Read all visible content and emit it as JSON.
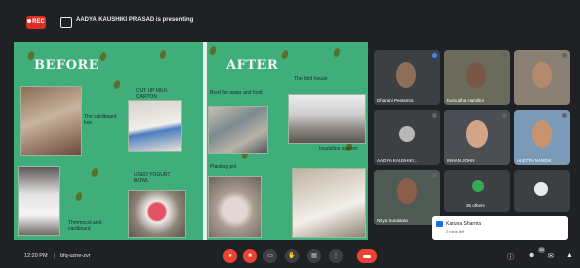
{
  "header": {
    "rec_label": "REC",
    "presenter_text": "AADYA KAUSHIKI PRASAD is presenting"
  },
  "slide": {
    "before_title": "BEFORE",
    "after_title": "AFTER",
    "labels": {
      "cardboard_box": "The cardboard box",
      "milk_carton": "CUT UP MILK CARTON",
      "yogurt_bowl": "USED YOGURT BOWL",
      "thermocol": "Thermocol and cardboard",
      "bowl_water": "Bowl for water and food",
      "bird_house": "The bird house",
      "planting_pot": "Planting pot",
      "insulation": "Insulation system"
    }
  },
  "participants": [
    {
      "name": "Dharani Peetamra"
    },
    {
      "name": "Kumudha Hamiltor"
    },
    {
      "name": ""
    },
    {
      "name": "AADYA KAUSHIKI..."
    },
    {
      "name": "INHAN JOHN"
    },
    {
      "name": "ALETTA NANDIK"
    },
    {
      "name": "Nitya Sundaran"
    },
    {
      "name": "35 others"
    },
    {
      "name": ""
    }
  ],
  "toast": {
    "name": "Karuna Sharma",
    "time": "2 mins left"
  },
  "bottom_bar": {
    "time": "12:20 PM",
    "separator": "|",
    "meeting_code": "bfq-uzne-zvr",
    "participant_badge": "38"
  },
  "colors": {
    "slide_bg": "#3fae7a",
    "rec_red": "#d93025",
    "end_call": "#ea4335"
  }
}
